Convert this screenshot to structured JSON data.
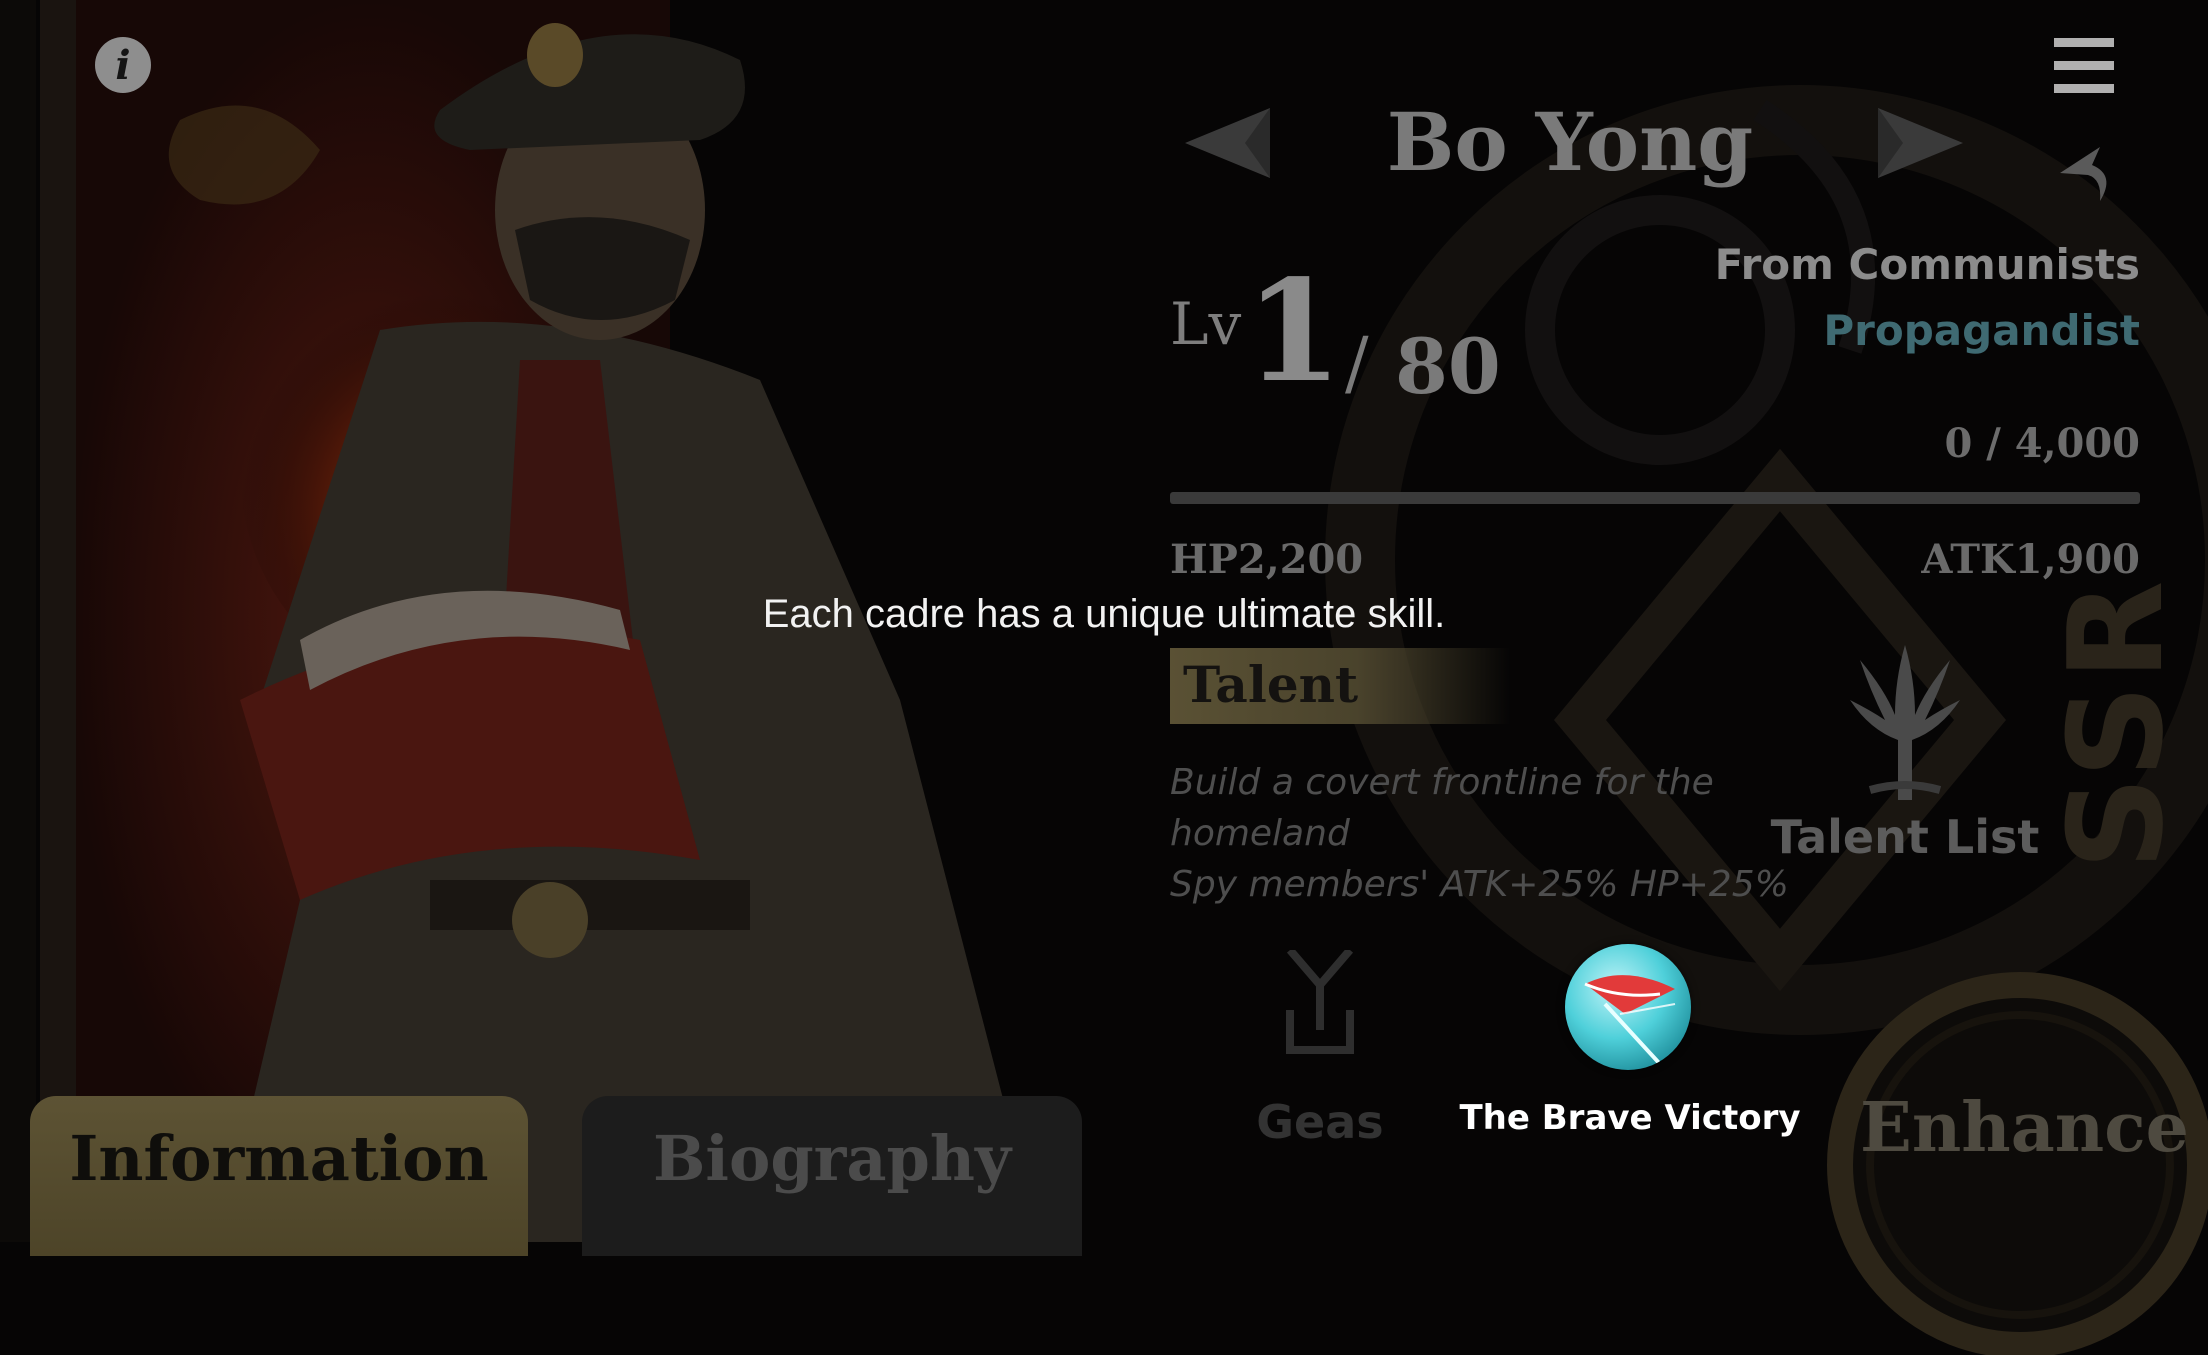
{
  "character": {
    "name": "Bo Yong",
    "faction": "From Communists",
    "class": "Propagandist",
    "rarity": "SSR"
  },
  "level": {
    "label": "Lv",
    "current": "1",
    "separator": "/",
    "max": "80"
  },
  "experience": {
    "text": "0 / 4,000",
    "progress_fraction": 0
  },
  "stats": {
    "hp": "HP2,200",
    "atk": "ATK1,900"
  },
  "tutorial": {
    "message": "Each cadre has a unique ultimate skill."
  },
  "talent": {
    "title": "Talent",
    "description_line1": "Build a covert frontline for the",
    "description_line2": "homeland",
    "effect": "Spy members' ATK+25% HP+25%",
    "list_label": "Talent List"
  },
  "geas": {
    "label": "Geas"
  },
  "ultimate_skill": {
    "name": "The Brave Victory"
  },
  "actions": {
    "enhance": "Enhance"
  },
  "tabs": {
    "information": "Information",
    "biography": "Biography"
  },
  "icons": {
    "info": "info-icon",
    "menu": "hamburger-menu-icon",
    "back": "back-arrow-icon",
    "prev": "left-triangle-icon",
    "next": "right-triangle-icon",
    "talent_tree": "tree-icon",
    "geas": "geas-icon",
    "skill": "flag-icon"
  },
  "colors": {
    "accent_gold": "#5d5334",
    "class_teal": "#3f6a72",
    "overlay_text": "#f2f2f2"
  }
}
